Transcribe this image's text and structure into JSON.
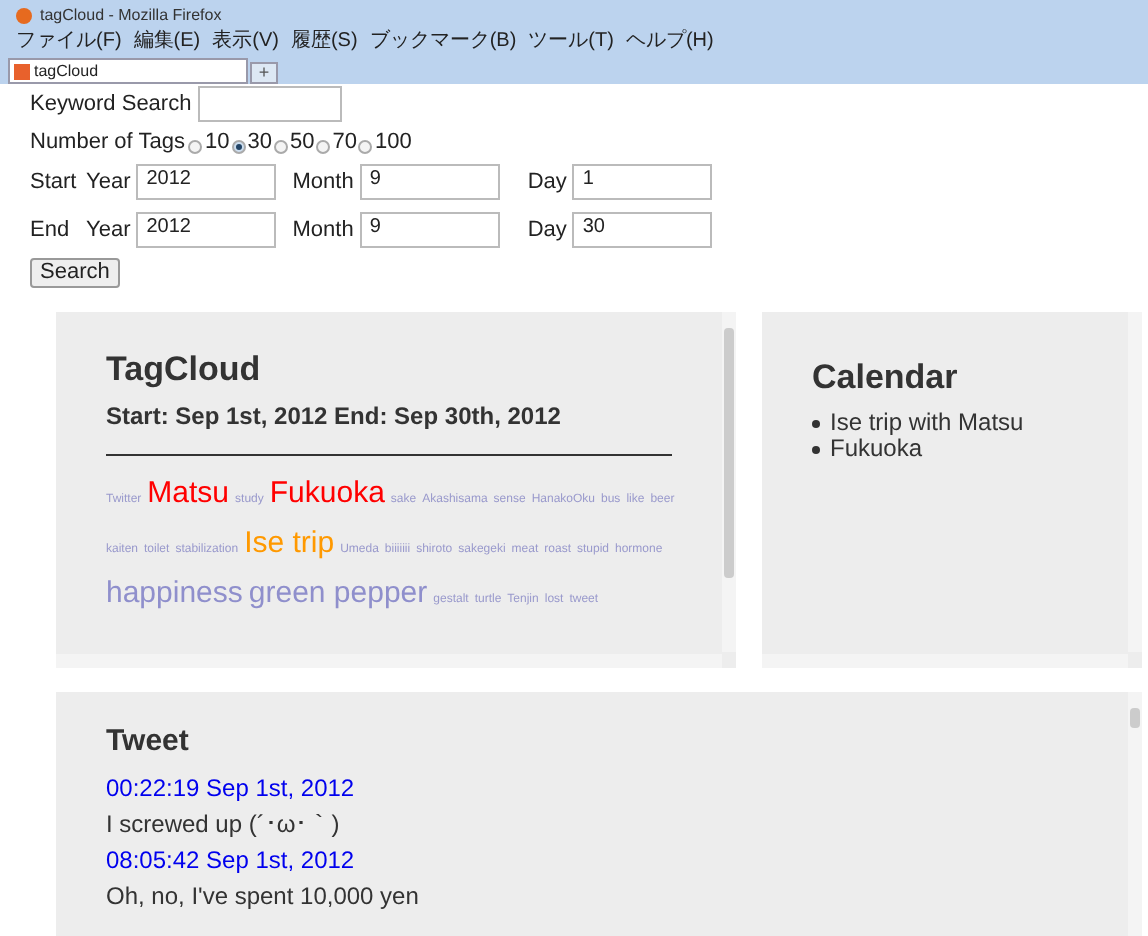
{
  "window": {
    "title": "tagCloud - Mozilla Firefox"
  },
  "menu": [
    "ファイル(F)",
    "編集(E)",
    "表示(V)",
    "履歴(S)",
    "ブックマーク(B)",
    "ツール(T)",
    "ヘルプ(H)"
  ],
  "tabs": [
    {
      "label": "tagCloud",
      "selected": true
    }
  ],
  "new_tab": "+",
  "form": {
    "keyword_label": "Keyword Search",
    "tags_label": "Number of Tags",
    "tag_options": [
      {
        "label": "10",
        "selected": false
      },
      {
        "label": "30",
        "selected": true
      },
      {
        "label": "50",
        "selected": false
      },
      {
        "label": "70",
        "selected": false
      },
      {
        "label": "100",
        "selected": false
      }
    ],
    "rows": [
      {
        "label": "Start",
        "fields": [
          {
            "label": "Year",
            "value": "2012"
          },
          {
            "label": "Month",
            "value": "9"
          },
          {
            "label": "Day",
            "value": "1"
          }
        ]
      },
      {
        "label": "End",
        "fields": [
          {
            "label": "Year",
            "value": "2012"
          },
          {
            "label": "Month",
            "value": "9"
          },
          {
            "label": "Day",
            "value": "30"
          }
        ]
      }
    ],
    "search_button": "Search"
  },
  "tagcloud": {
    "title": "TagCloud",
    "subtitle": "Start: Sep 1st, 2012 End: Sep 30th, 2012",
    "tags": [
      {
        "text": "Twitter",
        "kind": "small",
        "color": "#9999cc"
      },
      {
        "text": "Matsu",
        "kind": "large",
        "color": "#ff0000"
      },
      {
        "text": "study",
        "kind": "small",
        "color": "#9999cc"
      },
      {
        "text": "Fukuoka",
        "kind": "large",
        "color": "#ff0000"
      },
      {
        "text": "sake",
        "kind": "small",
        "color": "#9999cc"
      },
      {
        "text": "Akashisama",
        "kind": "small",
        "color": "#9999cc"
      },
      {
        "text": "sense",
        "kind": "small",
        "color": "#9999cc"
      },
      {
        "text": "HanakoOku",
        "kind": "small",
        "color": "#9999cc"
      },
      {
        "text": "bus",
        "kind": "small",
        "color": "#9999cc"
      },
      {
        "text": "like",
        "kind": "small",
        "color": "#9999cc"
      },
      {
        "text": "beer",
        "kind": "small",
        "color": "#9999cc"
      },
      {
        "text": "kaiten",
        "kind": "small",
        "color": "#9999cc"
      },
      {
        "text": "toilet",
        "kind": "small",
        "color": "#9999cc"
      },
      {
        "text": "stabilization",
        "kind": "small",
        "color": "#9999cc"
      },
      {
        "text": "Ise trip",
        "kind": "large",
        "color": "#ff9900"
      },
      {
        "text": "Umeda",
        "kind": "small",
        "color": "#9999cc"
      },
      {
        "text": "biiiiiii",
        "kind": "small",
        "color": "#9999cc"
      },
      {
        "text": "shiroto",
        "kind": "small",
        "color": "#9999cc"
      },
      {
        "text": "sakegeki",
        "kind": "small",
        "color": "#9999cc"
      },
      {
        "text": "meat",
        "kind": "small",
        "color": "#9999cc"
      },
      {
        "text": "roast",
        "kind": "small",
        "color": "#9999cc"
      },
      {
        "text": "stupid",
        "kind": "small",
        "color": "#9999cc"
      },
      {
        "text": "hormone",
        "kind": "small",
        "color": "#9999cc"
      },
      {
        "text": "happiness",
        "kind": "large",
        "color": "#8f8fcc"
      },
      {
        "text": "green pepper",
        "kind": "large",
        "color": "#8f8fcc"
      },
      {
        "text": "gestalt",
        "kind": "small",
        "color": "#9999cc"
      },
      {
        "text": "turtle",
        "kind": "small",
        "color": "#9999cc"
      },
      {
        "text": "Tenjin",
        "kind": "small",
        "color": "#9999cc"
      },
      {
        "text": "lost",
        "kind": "small",
        "color": "#9999cc"
      },
      {
        "text": "tweet",
        "kind": "small",
        "color": "#9999cc"
      }
    ]
  },
  "calendar": {
    "title": "Calendar",
    "items": [
      "Ise trip with Matsu",
      "Fukuoka"
    ]
  },
  "tweet": {
    "title": "Tweet",
    "entries": [
      {
        "time": "00:22:19 Sep 1st, 2012",
        "text": "I screwed up (´･ω･｀)"
      },
      {
        "time": "08:05:42 Sep 1st, 2012",
        "text": "Oh, no, I've spent 10,000 yen"
      }
    ]
  }
}
